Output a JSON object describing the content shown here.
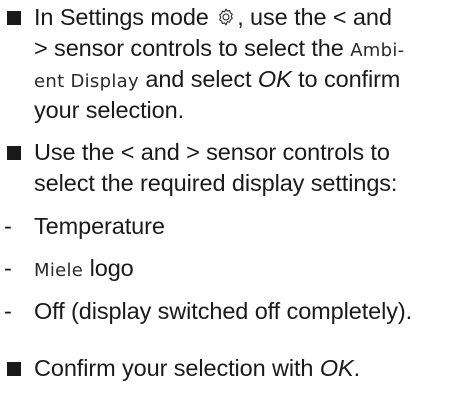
{
  "steps": [
    {
      "lines": [
        {
          "before": "In Settings mode ",
          "after": ", use the < and"
        },
        {
          "before": "> sensor controls to select the ",
          "disp": "Ambi-"
        },
        {
          "disp": "ent Display",
          "before": " and select ",
          "ok": "OK",
          "after": " to confirm"
        },
        {
          "before": "your selection."
        }
      ]
    },
    {
      "lines": [
        {
          "before": "Use the < and > sensor controls to"
        },
        {
          "before": "select the required display settings:"
        }
      ]
    },
    {
      "dash": "-",
      "lines": [
        {
          "before": "Temperature"
        }
      ]
    },
    {
      "dash": "-",
      "lines": [
        {
          "disp": "Miele",
          "before": " logo"
        }
      ]
    },
    {
      "dash": "-",
      "lines": [
        {
          "before": "Off (display switched off completely)."
        }
      ]
    },
    {
      "lines": [
        {
          "before": "Confirm your selection with ",
          "ok": "OK",
          "after": "."
        }
      ]
    }
  ],
  "icons": {
    "settings": "gear-icon"
  },
  "colors": {
    "text": "#1a1a1a",
    "background": "#ffffff"
  }
}
